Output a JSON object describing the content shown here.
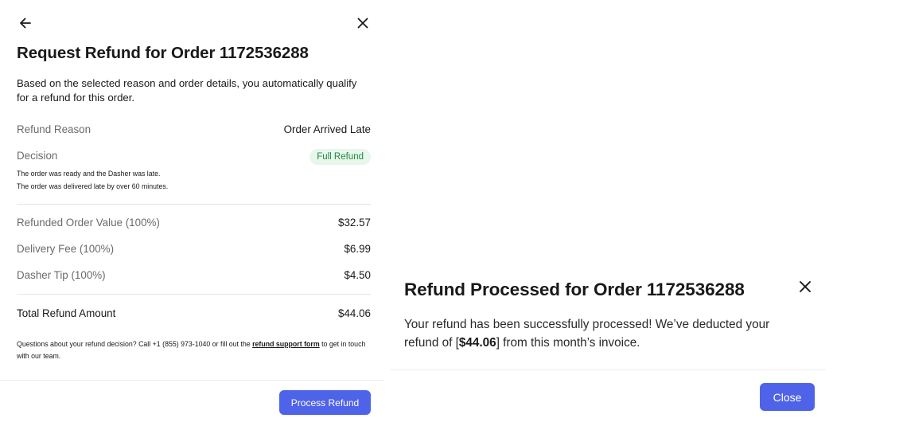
{
  "icons": {
    "back": "arrow-left-icon",
    "close": "close-icon"
  },
  "request_modal": {
    "title": "Request Refund for Order 1172536288",
    "description": "Based on the selected reason and order details, you automatically qualify for a refund for this order.",
    "refund_reason_label": "Refund Reason",
    "refund_reason_value": "Order Arrived Late",
    "decision_label": "Decision",
    "decision_value": "Full Refund",
    "decision_notes": [
      "The order was ready and the Dasher was late.",
      "The order was delivered late by over 60 minutes."
    ],
    "line_items": [
      {
        "label": "Refunded Order Value (100%)",
        "value": "$32.57"
      },
      {
        "label": "Delivery Fee (100%)",
        "value": "$6.99"
      },
      {
        "label": "Dasher Tip (100%)",
        "value": "$4.50"
      }
    ],
    "total_label": "Total Refund Amount",
    "total_value": "$44.06",
    "footer_text_before": "Questions about your refund decision? Call +1 (855) 973-1040 or fill out the ",
    "footer_link": "refund support form",
    "footer_text_after": " to get in touch with our team.",
    "process_button": "Process Refund"
  },
  "processed_modal": {
    "title": "Refund Processed for Order  1172536288",
    "message_before": "Your refund has been successfully processed! We’ve deducted your refund of [",
    "amount": "$44.06",
    "message_after": "] from this month’s invoice.",
    "close_button": "Close"
  },
  "colors": {
    "primary_button": "#4f63e8",
    "badge_bg": "#e8f6ec",
    "badge_text": "#1d8a3f"
  }
}
